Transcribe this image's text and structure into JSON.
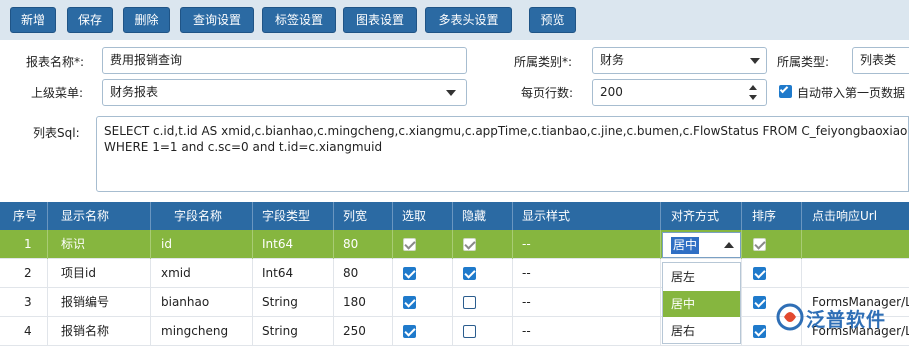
{
  "toolbar": {
    "buttons": [
      {
        "label": "新增"
      },
      {
        "label": "保存"
      },
      {
        "label": "删除"
      },
      {
        "label": "查询设置"
      },
      {
        "label": "标签设置"
      },
      {
        "label": "图表设置"
      },
      {
        "label": "多表头设置"
      },
      {
        "label": "预览"
      }
    ],
    "bg_color": "#dbe6ef",
    "button_color": "#2b6aa3"
  },
  "form": {
    "report_name": {
      "label": "报表名称*:",
      "value": "费用报销查询"
    },
    "category": {
      "label": "所属类别*:",
      "value": "财务"
    },
    "type": {
      "label": "所属类型:",
      "value": "列表类"
    },
    "parent_menu": {
      "label": "上级菜单:",
      "value": "财务报表"
    },
    "rows_per_page": {
      "label": "每页行数:",
      "value": "200"
    },
    "auto_first_page": {
      "label": "自动带入第一页数据",
      "checked": true
    }
  },
  "sql": {
    "label": "列表Sql:",
    "line1": "SELECT c.id,t.id AS xmid,c.bianhao,c.mingcheng,c.xiangmu,c.appTime,c.tianbao,c.jine,c.bumen,c.FlowStatus FROM C_feiyongbaoxiao c,T",
    "line2": "WHERE 1=1 and c.sc=0 and t.id=c.xiangmuid"
  },
  "grid": {
    "headers": [
      "序号",
      "显示名称",
      "字段名称",
      "字段类型",
      "列宽",
      "选取",
      "隐藏",
      "显示样式",
      "对齐方式",
      "排序",
      "点击响应Url"
    ],
    "rows": [
      {
        "seq": "1",
        "display": "标识",
        "field": "id",
        "type": "Int64",
        "width": "80",
        "pick": true,
        "hide": true,
        "style": "--",
        "align": "居中",
        "sort": true,
        "url": "",
        "selected": true
      },
      {
        "seq": "2",
        "display": "项目id",
        "field": "xmid",
        "type": "Int64",
        "width": "80",
        "pick": true,
        "hide": true,
        "style": "--",
        "align": "",
        "sort": true,
        "url": "",
        "selected": false
      },
      {
        "seq": "3",
        "display": "报销编号",
        "field": "bianhao",
        "type": "String",
        "width": "180",
        "pick": true,
        "hide": false,
        "style": "--",
        "align": "",
        "sort": true,
        "url": "FormsManager/L",
        "selected": false
      },
      {
        "seq": "4",
        "display": "报销名称",
        "field": "mingcheng",
        "type": "String",
        "width": "250",
        "pick": true,
        "hide": false,
        "style": "--",
        "align": "",
        "sort": true,
        "url": "FormsManager/L",
        "selected": false
      }
    ],
    "header_color": "#2b6aa3",
    "selected_row_color": "#86b63f"
  },
  "align_dropdown": {
    "current": "居中",
    "options": [
      "居左",
      "居中",
      "居右"
    ],
    "highlighted": "居中"
  },
  "logo": {
    "text": "泛普软件"
  }
}
